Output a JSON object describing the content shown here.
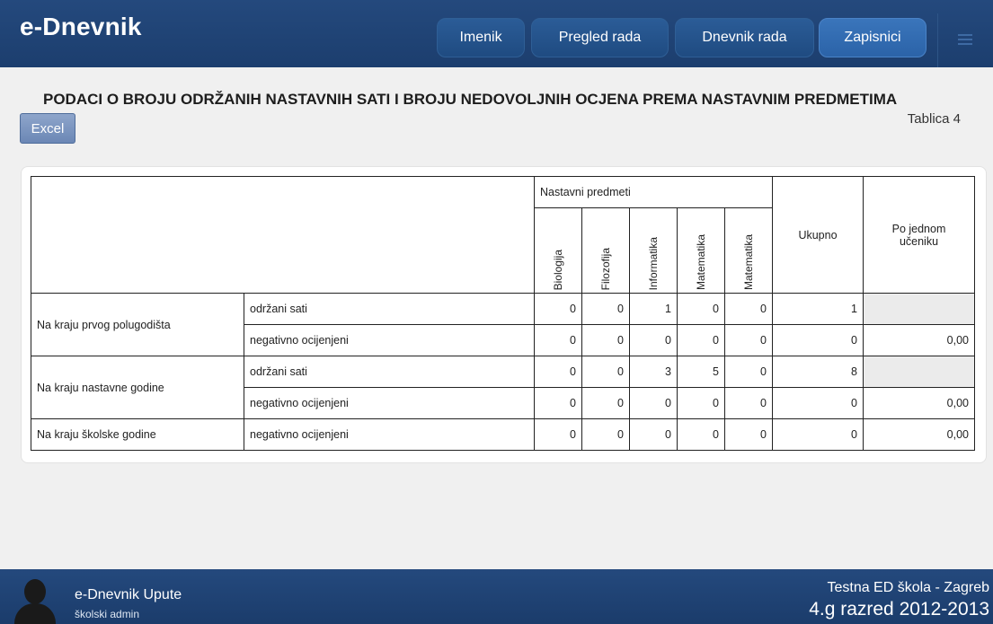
{
  "app": {
    "title": "e-Dnevnik"
  },
  "nav": [
    {
      "label": "Imenik",
      "active": false
    },
    {
      "label": "Pregled rada",
      "active": false
    },
    {
      "label": "Dnevnik rada",
      "active": false
    },
    {
      "label": "Zapisnici",
      "active": true
    }
  ],
  "report": {
    "title": "PODACI O BROJU ODRŽANIH NASTAVNIH SATI I BROJU NEDOVOLJNIH OCJENA PREMA NASTAVNIM PREDMETIMA",
    "table_label": "Tablica 4",
    "excel_label": "Excel"
  },
  "table": {
    "group_header": "Nastavni predmeti",
    "subjects": [
      "Biologija",
      "Filozofija",
      "Informatika",
      "Matematika",
      "Matematika"
    ],
    "total_header": "Ukupno",
    "per_student_header": "Po jednom učeniku",
    "periods": [
      {
        "label": "Na kraju prvog polugodišta",
        "rows": [
          {
            "type": "održani sati",
            "values": [
              "0",
              "0",
              "1",
              "0",
              "0"
            ],
            "total": "1",
            "per_student": ""
          },
          {
            "type": "negativno ocijenjeni",
            "values": [
              "0",
              "0",
              "0",
              "0",
              "0"
            ],
            "total": "0",
            "per_student": "0,00"
          }
        ]
      },
      {
        "label": "Na kraju nastavne godine",
        "rows": [
          {
            "type": "održani sati",
            "values": [
              "0",
              "0",
              "3",
              "5",
              "0"
            ],
            "total": "8",
            "per_student": ""
          },
          {
            "type": "negativno ocijenjeni",
            "values": [
              "0",
              "0",
              "0",
              "0",
              "0"
            ],
            "total": "0",
            "per_student": "0,00"
          }
        ]
      },
      {
        "label": "Na kraju školske godine",
        "rows": [
          {
            "type": "negativno ocijenjeni",
            "values": [
              "0",
              "0",
              "0",
              "0",
              "0"
            ],
            "total": "0",
            "per_student": "0,00"
          }
        ]
      }
    ]
  },
  "footer": {
    "link": "e-Dnevnik Upute",
    "role": "školski admin",
    "school": "Testna ED škola - Zagreb",
    "class_year": "4.g razred 2012-2013"
  },
  "colors": {
    "header_bg": "#1f4475",
    "nav_active": "#2b63a8",
    "excel_button": "#7a93bf",
    "grey_cell": "#ebebeb"
  },
  "icons": [
    "menu-icon",
    "user-avatar-icon"
  ]
}
